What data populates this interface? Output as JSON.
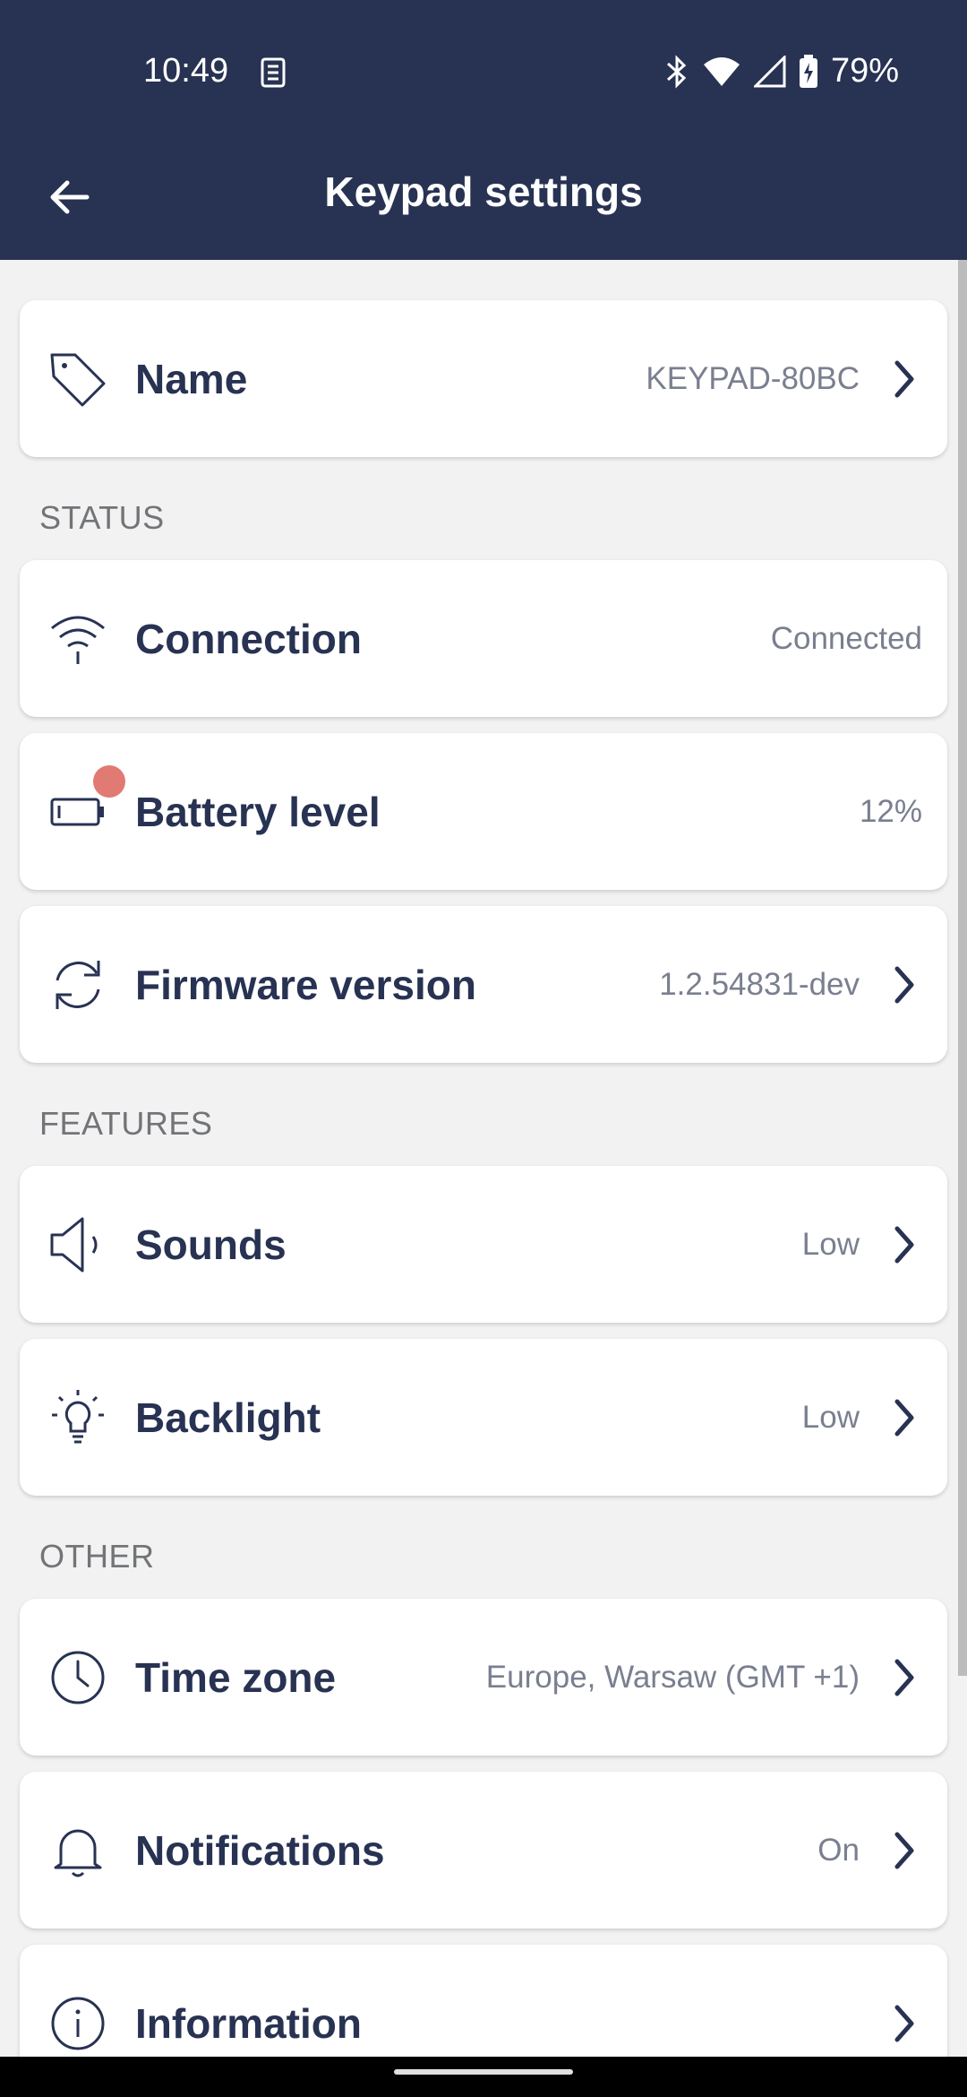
{
  "status_bar": {
    "time": "10:49",
    "battery": "79%"
  },
  "app_bar": {
    "title": "Keypad settings"
  },
  "items": {
    "name": {
      "label": "Name",
      "value": "KEYPAD-80BC"
    },
    "connection": {
      "label": "Connection",
      "value": "Connected"
    },
    "battery": {
      "label": "Battery level",
      "value": "12%"
    },
    "firmware": {
      "label": "Firmware version",
      "value": "1.2.54831-dev"
    },
    "sounds": {
      "label": "Sounds",
      "value": "Low"
    },
    "backlight": {
      "label": "Backlight",
      "value": "Low"
    },
    "timezone": {
      "label": "Time zone",
      "value": "Europe, Warsaw (GMT +1)"
    },
    "notifications": {
      "label": "Notifications",
      "value": "On"
    },
    "information": {
      "label": "Information"
    }
  },
  "sections": {
    "status": "STATUS",
    "features": "FEATURES",
    "other": "OTHER"
  },
  "colors": {
    "header_bg": "#283252",
    "accent_text": "#283252",
    "alert_dot": "#e07a73",
    "page_bg": "#f2f2f2"
  }
}
